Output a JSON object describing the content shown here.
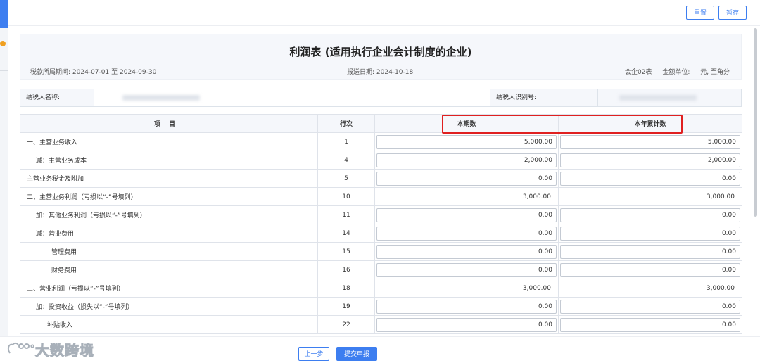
{
  "toolbar": {
    "reset_label": "重置",
    "save_label": "暂存"
  },
  "report": {
    "title": "利润表 (适用执行企业会计制度的企业)",
    "period_label": "税款所属期间:",
    "period_start": "2024-07-01",
    "period_sep": "至",
    "period_end": "2024-09-30",
    "report_date_label": "报送日期:",
    "report_date": "2024-10-18",
    "form_code": "会企02表",
    "unit_label": "金额单位:",
    "unit_value": "元, 至角分"
  },
  "taxpayer": {
    "name_label": "纳税人名称:",
    "id_label": "纳税人识别号:"
  },
  "table": {
    "headers": {
      "item": "项目",
      "line": "行次",
      "current": "本期数",
      "ytd": "本年累计数"
    },
    "rows": [
      {
        "item": "一、主营业务收入",
        "line": "1",
        "current": "5,000.00",
        "ytd": "5,000.00",
        "editable": true,
        "indent": 0
      },
      {
        "item": "减：主营业务成本",
        "line": "4",
        "current": "2,000.00",
        "ytd": "2,000.00",
        "editable": true,
        "indent": 1
      },
      {
        "item": "主营业务税金及附加",
        "line": "5",
        "current": "0.00",
        "ytd": "0.00",
        "editable": true,
        "indent": 0
      },
      {
        "item": "二、主营业务利润（亏损以“-”号填列）",
        "line": "10",
        "current": "3,000.00",
        "ytd": "3,000.00",
        "editable": false,
        "indent": 0
      },
      {
        "item": "加：其他业务利润（亏损以“-”号填列）",
        "line": "11",
        "current": "0.00",
        "ytd": "0.00",
        "editable": true,
        "indent": 1
      },
      {
        "item": "减：营业费用",
        "line": "14",
        "current": "0.00",
        "ytd": "0.00",
        "editable": true,
        "indent": 1
      },
      {
        "item": "管理费用",
        "line": "15",
        "current": "0.00",
        "ytd": "0.00",
        "editable": true,
        "indent": 3
      },
      {
        "item": "财务费用",
        "line": "16",
        "current": "0.00",
        "ytd": "0.00",
        "editable": true,
        "indent": 3
      },
      {
        "item": "三、营业利润（亏损以“-”号填列）",
        "line": "18",
        "current": "3,000.00",
        "ytd": "3,000.00",
        "editable": false,
        "indent": 0
      },
      {
        "item": "加：投资收益（损失以“-”号填列）",
        "line": "19",
        "current": "0.00",
        "ytd": "0.00",
        "editable": true,
        "indent": 1
      },
      {
        "item": "补贴收入",
        "line": "22",
        "current": "0.00",
        "ytd": "0.00",
        "editable": true,
        "indent": 2
      }
    ]
  },
  "footer": {
    "prev_label": "上一步",
    "submit_label": "提交申报"
  },
  "watermark": {
    "text": "大数跨境"
  },
  "colors": {
    "accent": "#3d7ef0",
    "highlight": "#e02020",
    "header_bg": "#f5f7fb"
  }
}
